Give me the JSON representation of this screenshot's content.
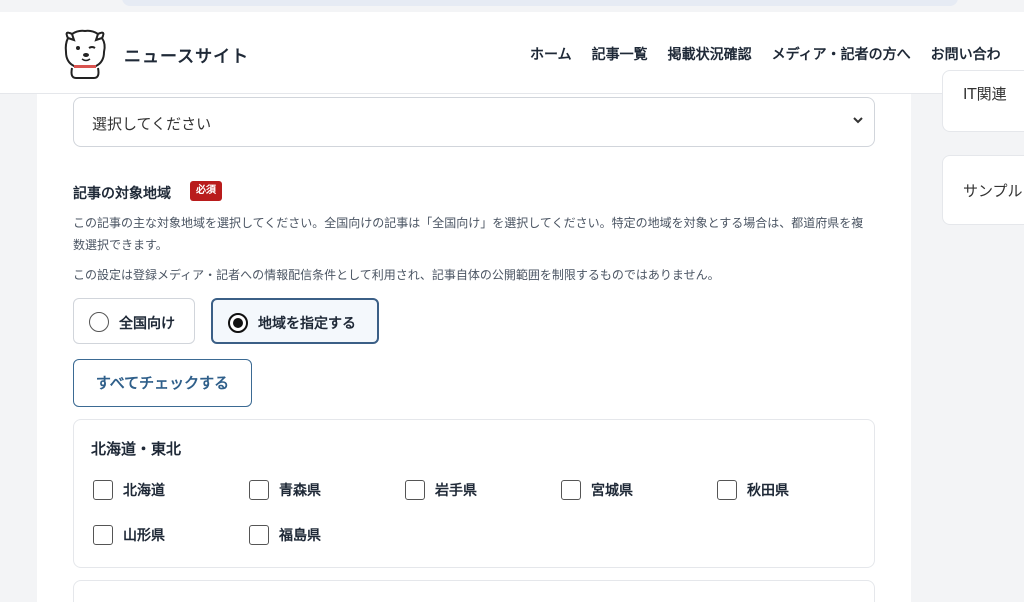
{
  "header": {
    "site_name": "ニュースサイト",
    "nav": [
      "ホーム",
      "記事一覧",
      "掲載状況確認",
      "メディア・記者の方へ",
      "お問い合わ"
    ]
  },
  "select": {
    "value": "選択してください"
  },
  "region_section": {
    "title": "記事の対象地域",
    "required": "必須",
    "help1": "この記事の主な対象地域を選択してください。全国向けの記事は「全国向け」を選択してください。特定の地域を対象とする場合は、都道府県を複数選択できます。",
    "help2": "この設定は登録メディア・記者への情報配信条件として利用され、記事自体の公開範囲を制限するものではありません。",
    "options": [
      "全国向け",
      "地域を指定する"
    ],
    "selected_option": "地域を指定する",
    "check_all": "すべてチェックする"
  },
  "region_group": {
    "title": "北海道・東北",
    "prefectures": [
      "北海道",
      "青森県",
      "岩手県",
      "宮城県",
      "秋田県",
      "山形県",
      "福島県"
    ]
  },
  "sidebar": {
    "item1": "IT関連",
    "item2": "サンプル"
  },
  "colors": {
    "accent": "#3b6a93",
    "required": "#b91c1c"
  }
}
